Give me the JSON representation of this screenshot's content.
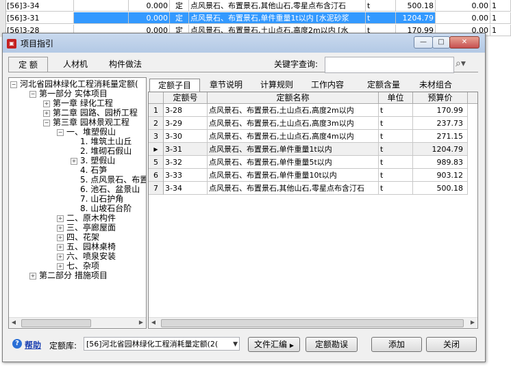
{
  "background_table": {
    "rows": [
      {
        "code": "[56]3-34",
        "amount": "0.000",
        "type": "定",
        "name": "点风景石、布置景石,其他山石,零星点布含汀石",
        "unit": "t",
        "price": "500.18",
        "qty": "0.00",
        "no": "1"
      },
      {
        "code": "[56]3-31",
        "amount": "0.000",
        "type": "定",
        "name": "点风景石、布置景石,单件重量1t以内 [水泥砂浆",
        "unit": "t",
        "price": "1204.79",
        "qty": "0.00",
        "no": "1"
      },
      {
        "code": "[56]3-28",
        "amount": "0.000",
        "type": "定",
        "name": "点风景石、布置景石,土山点石,高度2m以内 [水",
        "unit": "t",
        "price": "170.99",
        "qty": "0.00",
        "no": "1"
      }
    ]
  },
  "window": {
    "title": "项目指引",
    "min_symbol": "—",
    "max_symbol": "□",
    "close_symbol": "✕",
    "top_tabs": [
      "定 额",
      "人材机",
      "构件做法"
    ],
    "keyword_label": "关键字查询:",
    "keyword_value": ""
  },
  "tree": {
    "nodes": [
      {
        "label": "河北省园林绿化工程消耗量定额(",
        "expander": "−"
      },
      {
        "label": "第一部分 实体项目",
        "expander": "−"
      },
      {
        "label": "第一章 绿化工程",
        "expander": "+"
      },
      {
        "label": "第二章 园路、园桥工程",
        "expander": "+"
      },
      {
        "label": "第三章 园林景观工程",
        "expander": "−"
      },
      {
        "label": "一、堆塑假山",
        "expander": "−"
      },
      {
        "label": "1. 堆筑土山丘",
        "expander": ""
      },
      {
        "label": "2. 堆砌石假山",
        "expander": ""
      },
      {
        "label": "3. 塑假山",
        "expander": "+"
      },
      {
        "label": "4. 石笋",
        "expander": ""
      },
      {
        "label": "5. 点风景石、布置景石",
        "expander": ""
      },
      {
        "label": "6. 池石、盆景山",
        "expander": ""
      },
      {
        "label": "7. 山石护角",
        "expander": ""
      },
      {
        "label": "8. 山坡石台阶",
        "expander": ""
      },
      {
        "label": "二、原木构件",
        "expander": "+"
      },
      {
        "label": "三、亭廊屋面",
        "expander": "+"
      },
      {
        "label": "四、花架",
        "expander": "+"
      },
      {
        "label": "五、园林桌椅",
        "expander": "+"
      },
      {
        "label": "六、喷泉安装",
        "expander": "+"
      },
      {
        "label": "七、杂项",
        "expander": "+"
      },
      {
        "label": "第二部分 措施项目",
        "expander": "+"
      }
    ]
  },
  "sub_tabs": [
    "定额子目",
    "章节说明",
    "计算规则",
    "工作内容",
    "定额含量",
    "未材组合"
  ],
  "grid": {
    "headers": {
      "code": "定额号",
      "name": "定额名称",
      "unit": "单位",
      "price": "预算价"
    },
    "rows": [
      {
        "idx": "1",
        "code": "3-28",
        "name": "点风景石、布置景石,土山点石,高度2m以内",
        "unit": "t",
        "price": "170.99"
      },
      {
        "idx": "2",
        "code": "3-29",
        "name": "点风景石、布置景石,土山点石,高度3m以内",
        "unit": "t",
        "price": "237.73"
      },
      {
        "idx": "3",
        "code": "3-30",
        "name": "点风景石、布置景石,土山点石,高度4m以内",
        "unit": "t",
        "price": "271.15"
      },
      {
        "idx": "▶",
        "code": "3-31",
        "name": "点风景石、布置景石,单件重量1t以内",
        "unit": "t",
        "price": "1204.79"
      },
      {
        "idx": "5",
        "code": "3-32",
        "name": "点风景石、布置景石,单件重量5t以内",
        "unit": "t",
        "price": "989.83"
      },
      {
        "idx": "6",
        "code": "3-33",
        "name": "点风景石、布置景石,单件重量10t以内",
        "unit": "t",
        "price": "903.12"
      },
      {
        "idx": "7",
        "code": "3-34",
        "name": "点风景石、布置景石,其他山石,零星点布含汀石",
        "unit": "t",
        "price": "500.18"
      }
    ]
  },
  "bottom": {
    "help_label": "帮助",
    "lib_label": "定额库:",
    "lib_value": "[56]河北省园林绿化工程消耗量定额(2(",
    "btn_summary": "文件汇编",
    "btn_errata": "定额勘误",
    "btn_add": "添加",
    "btn_close": "关闭"
  }
}
